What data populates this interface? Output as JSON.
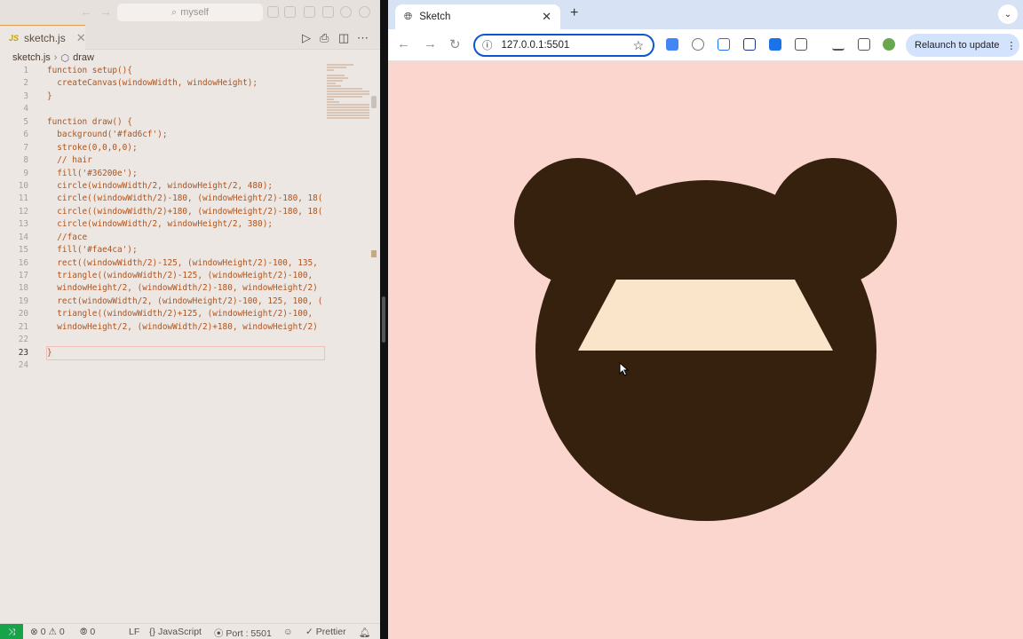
{
  "editor": {
    "title_search": "myself",
    "tab": {
      "icon": "JS",
      "label": "sketch.js"
    },
    "breadcrumb": {
      "file": "sketch.js",
      "symbol": "draw"
    },
    "lines": [
      {
        "n": "1",
        "code": "function setup(){"
      },
      {
        "n": "2",
        "code": "  createCanvas(windowWidth, windowHeight);"
      },
      {
        "n": "3",
        "code": "}"
      },
      {
        "n": "4",
        "code": ""
      },
      {
        "n": "5",
        "code": "function draw() {"
      },
      {
        "n": "6",
        "code": "  background('#fad6cf');"
      },
      {
        "n": "7",
        "code": "  stroke(0,0,0,0);"
      },
      {
        "n": "8",
        "code": "  // hair"
      },
      {
        "n": "9",
        "code": "  fill('#36200e');"
      },
      {
        "n": "10",
        "code": "  circle(windowWidth/2, windowHeight/2, 480);"
      },
      {
        "n": "11",
        "code": "  circle((windowWidth/2)-180, (windowHeight/2)-180, 18("
      },
      {
        "n": "12",
        "code": "  circle((windowWidth/2)+180, (windowHeight/2)-180, 18("
      },
      {
        "n": "13",
        "code": "  circle(windowWidth/2, windowHeight/2, 380);"
      },
      {
        "n": "14",
        "code": "  //face"
      },
      {
        "n": "15",
        "code": "  fill('#fae4ca');"
      },
      {
        "n": "16",
        "code": "  rect((windowWidth/2)-125, (windowHeight/2)-100, 135,"
      },
      {
        "n": "17",
        "code": "  triangle((windowWidth/2)-125, (windowHeight/2)-100,"
      },
      {
        "n": "18",
        "code": "  windowHeight/2, (windowWidth/2)-180, windowHeight/2)"
      },
      {
        "n": "19",
        "code": "  rect(windowWidth/2, (windowHeight/2)-100, 125, 100, ("
      },
      {
        "n": "20",
        "code": "  triangle((windowWidth/2)+125, (windowHeight/2)-100,"
      },
      {
        "n": "21",
        "code": "  windowHeight/2, (windowWidth/2)+180, windowHeight/2)"
      },
      {
        "n": "22",
        "code": ""
      },
      {
        "n": "23",
        "code": "}"
      },
      {
        "n": "24",
        "code": ""
      }
    ],
    "status": {
      "errors": "0",
      "warnings": "0",
      "ports": "0",
      "eol": "LF",
      "language": "JavaScript",
      "port": "Port : 5501",
      "prettier": "Prettier"
    }
  },
  "browser": {
    "tab_title": "Sketch",
    "url": "127.0.0.1:5501",
    "relaunch_label": "Relaunch to update",
    "colors": {
      "background": "#fad6cf",
      "hair": "#36200e",
      "face": "#fae4ca"
    }
  }
}
